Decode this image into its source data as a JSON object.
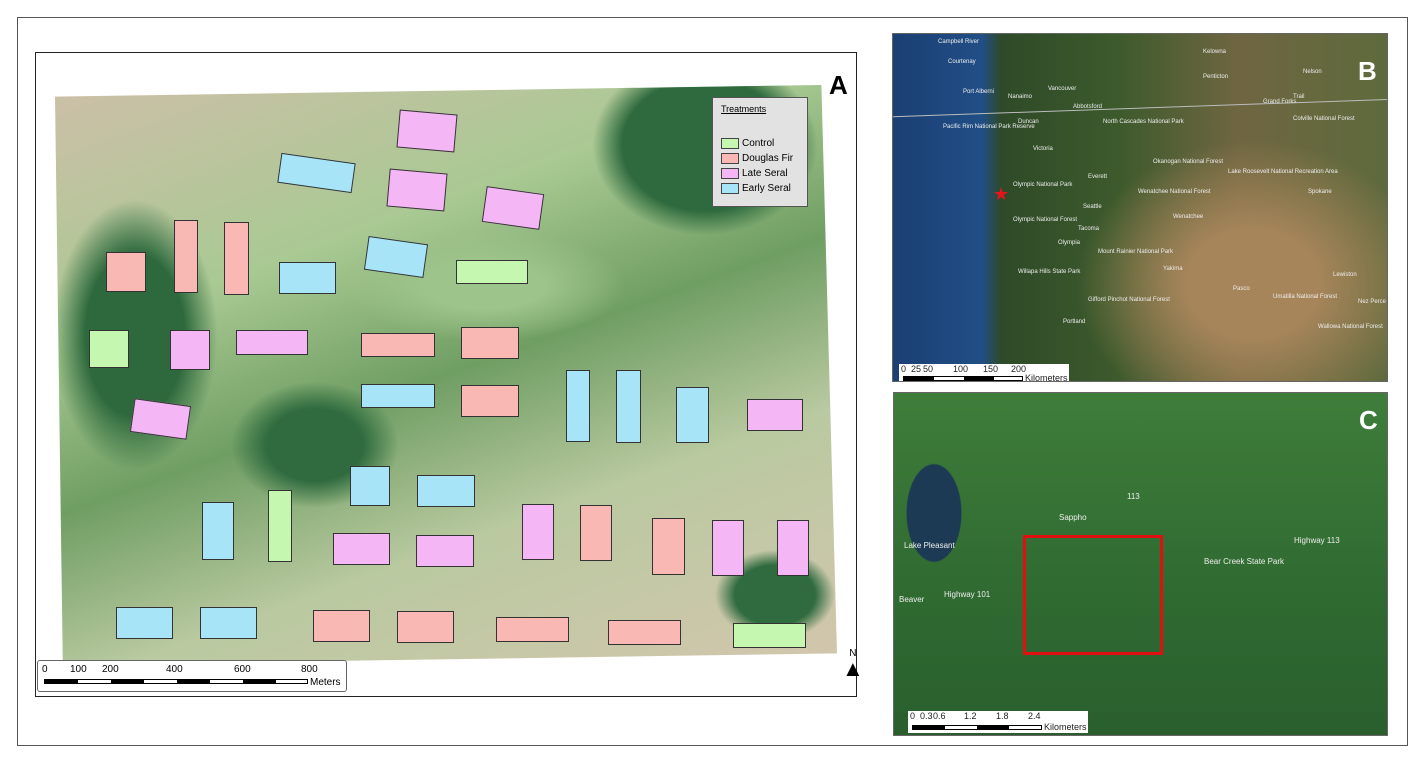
{
  "panel_a": {
    "label": "A",
    "legend": {
      "title": "Treatments",
      "items": [
        {
          "name": "Control",
          "color": "#c6f7b0"
        },
        {
          "name": "Douglas Fir",
          "color": "#f9b8b3"
        },
        {
          "name": "Late Seral",
          "color": "#f5b6f5"
        },
        {
          "name": "Early Seral",
          "color": "#a8e4f7"
        }
      ]
    },
    "scale": {
      "ticks": [
        "0",
        "100",
        "200",
        "400",
        "600",
        "800"
      ],
      "unit": "Meters"
    },
    "north": "N",
    "plots": [
      "late",
      "early",
      "late",
      "late",
      "douglas",
      "douglas",
      "douglas",
      "early",
      "early",
      "control",
      "control",
      "late",
      "late",
      "douglas",
      "douglas",
      "early",
      "douglas",
      "early",
      "early",
      "early",
      "late",
      "late",
      "early",
      "early",
      "early",
      "control",
      "late",
      "late",
      "late",
      "douglas",
      "douglas",
      "late",
      "late",
      "early",
      "early",
      "douglas",
      "douglas",
      "douglas",
      "douglas",
      "control"
    ]
  },
  "panel_b": {
    "label": "B",
    "places": [
      "Campbell River",
      "Courtenay",
      "Port Alberni",
      "Nanaimo",
      "Vancouver",
      "Abbotsford",
      "Duncan",
      "Victoria",
      "Pacific Rim National Park Reserve",
      "Kelowna",
      "Penticton",
      "Nelson",
      "Grand Forks",
      "Trail",
      "North Cascades National Park",
      "Okanogan National Forest",
      "Lake Roosevelt National Recreation Area",
      "Colville National Forest",
      "Everett",
      "Seattle",
      "Tacoma",
      "Olympia",
      "Olympic National Park",
      "Olympic National Forest",
      "Wenatchee",
      "Wenatchee National Forest",
      "Spokane",
      "Mount Rainier National Park",
      "Yakima",
      "Willapa Hills State Park",
      "Gifford Pinchot National Forest",
      "Portland",
      "Pasco",
      "Umatilla National Forest",
      "Lewiston",
      "Nez Perce National Historical Park",
      "Wallowa National Forest"
    ],
    "scale": {
      "ticks": [
        "0",
        "25",
        "50",
        "100",
        "150",
        "200"
      ],
      "unit": "Kilometers"
    },
    "site_marker_color": "#e8141b"
  },
  "panel_c": {
    "label": "C",
    "places": [
      "Lake Pleasant",
      "Sappho",
      "Beaver",
      "Highway 101",
      "Highway 113",
      "113",
      "Bear Creek State Park"
    ],
    "scale": {
      "ticks": [
        "0",
        "0.3",
        "0.6",
        "1.2",
        "1.8",
        "2.4"
      ],
      "unit": "Kilometers"
    },
    "box_color": "#e01010"
  }
}
